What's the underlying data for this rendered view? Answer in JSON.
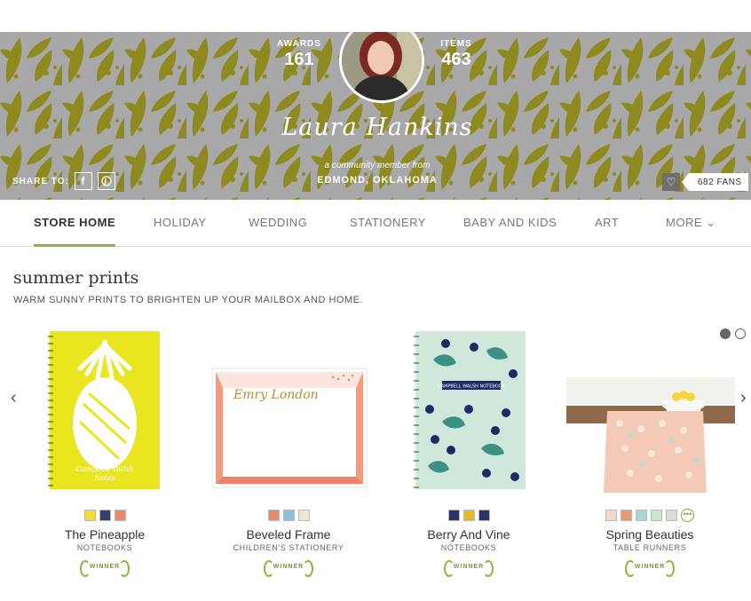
{
  "profile": {
    "awards_label": "AWARDS",
    "awards_value": "161",
    "items_label": "ITEMS",
    "items_value": "463",
    "name": "Laura Hankins",
    "member_text": "a community member from",
    "location": "EDMOND, OKLAHOMA",
    "share_label": "SHARE TO:",
    "share_icons": [
      "facebook-icon",
      "pinterest-icon"
    ],
    "fans": "682 FANS"
  },
  "nav": {
    "tabs": [
      {
        "label": "STORE HOME",
        "active": true
      },
      {
        "label": "HOLIDAY"
      },
      {
        "label": "WEDDING"
      },
      {
        "label": "STATIONERY"
      },
      {
        "label": "BABY AND KIDS"
      },
      {
        "label": "ART"
      },
      {
        "label": "MORE ⌄"
      }
    ]
  },
  "section": {
    "title": "summer prints",
    "subtitle": "WARM SUNNY PRINTS TO BRIGHTEN UP YOUR MAILBOX AND HOME."
  },
  "products": [
    {
      "name": "The Pineapple",
      "category": "NOTEBOOKS",
      "badge": "WINNER",
      "swatches": [
        "#f2dc3a",
        "#343f6b",
        "#e88a6e"
      ],
      "image_text": "Campbell Walsh Notes"
    },
    {
      "name": "Beveled Frame",
      "category": "CHILDREN'S STATIONERY",
      "badge": "WINNER",
      "swatches": [
        "#e8896c",
        "#8fbfd2",
        "#ece6d6"
      ],
      "image_text": "Emry London"
    },
    {
      "name": "Berry And Vine",
      "category": "NOTEBOOKS",
      "badge": "WINNER",
      "swatches": [
        "#2a3566",
        "#e6b91e",
        "#2a3566"
      ],
      "image_text": "CAMPBELL WALSH NOTEBOOK"
    },
    {
      "name": "Spring Beauties",
      "category": "TABLE RUNNERS",
      "badge": "WINNER",
      "swatches": [
        "#f6d6cc",
        "#e99a78",
        "#a8d8d4",
        "#cbe7c9",
        "#dcdcd0"
      ],
      "has_more": true
    }
  ],
  "colors": {
    "accent": "#8cb63c",
    "banner_pattern": "#8e8a1f",
    "banner_bg": "#a8a8a8"
  }
}
